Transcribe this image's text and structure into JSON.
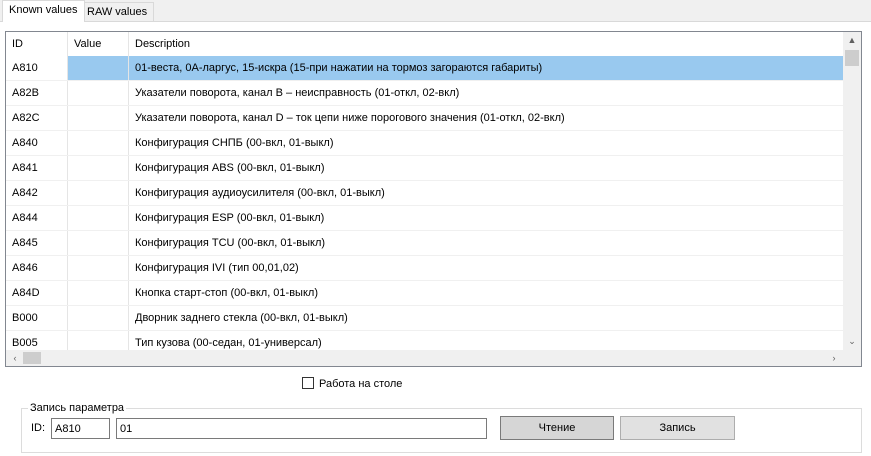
{
  "tabs": [
    {
      "label": "Known values",
      "active": true
    },
    {
      "label": "RAW values",
      "active": false
    }
  ],
  "table": {
    "columns": [
      "ID",
      "Value",
      "Description"
    ],
    "rows": [
      {
        "id": "A810",
        "value": "",
        "desc": "01-веста, 0А-ларгус, 15-искра (15-при нажатии на тормоз загораются габариты)",
        "selected": true
      },
      {
        "id": "A82B",
        "value": "",
        "desc": "Указатели поворота, канал В – неисправность (01-откл, 02-вкл)"
      },
      {
        "id": "A82C",
        "value": "",
        "desc": "Указатели поворота, канал D – ток цепи ниже порогового значения (01-откл, 02-вкл)"
      },
      {
        "id": "A840",
        "value": "",
        "desc": "Конфигурация СНПБ (00-вкл, 01-выкл)"
      },
      {
        "id": "A841",
        "value": "",
        "desc": "Конфигурация ABS (00-вкл, 01-выкл)"
      },
      {
        "id": "A842",
        "value": "",
        "desc": "Конфигурация аудиоусилителя (00-вкл, 01-выкл)"
      },
      {
        "id": "A844",
        "value": "",
        "desc": "Конфигурация ESP (00-вкл, 01-выкл)"
      },
      {
        "id": "A845",
        "value": "",
        "desc": "Конфигурация TCU (00-вкл, 01-выкл)"
      },
      {
        "id": "A846",
        "value": "",
        "desc": "Конфигурация IVI (тип 00,01,02)"
      },
      {
        "id": "A84D",
        "value": "",
        "desc": "Кнопка старт-стоп (00-вкл, 01-выкл)"
      },
      {
        "id": "B000",
        "value": "",
        "desc": "Дворник заднего стекла (00-вкл, 01-выкл)"
      },
      {
        "id": "B005",
        "value": "",
        "desc": "Тип кузова (00-седан, 01-универсал)"
      }
    ]
  },
  "checkbox": {
    "label": "Работа на столе",
    "checked": false
  },
  "write_group": {
    "title": "Запись параметра",
    "id_label": "ID:",
    "id_value": "A810",
    "value": "01",
    "read_label": "Чтение",
    "write_label": "Запись"
  },
  "colors": {
    "selection": "#99c9ef",
    "accent_border": "#828790"
  }
}
